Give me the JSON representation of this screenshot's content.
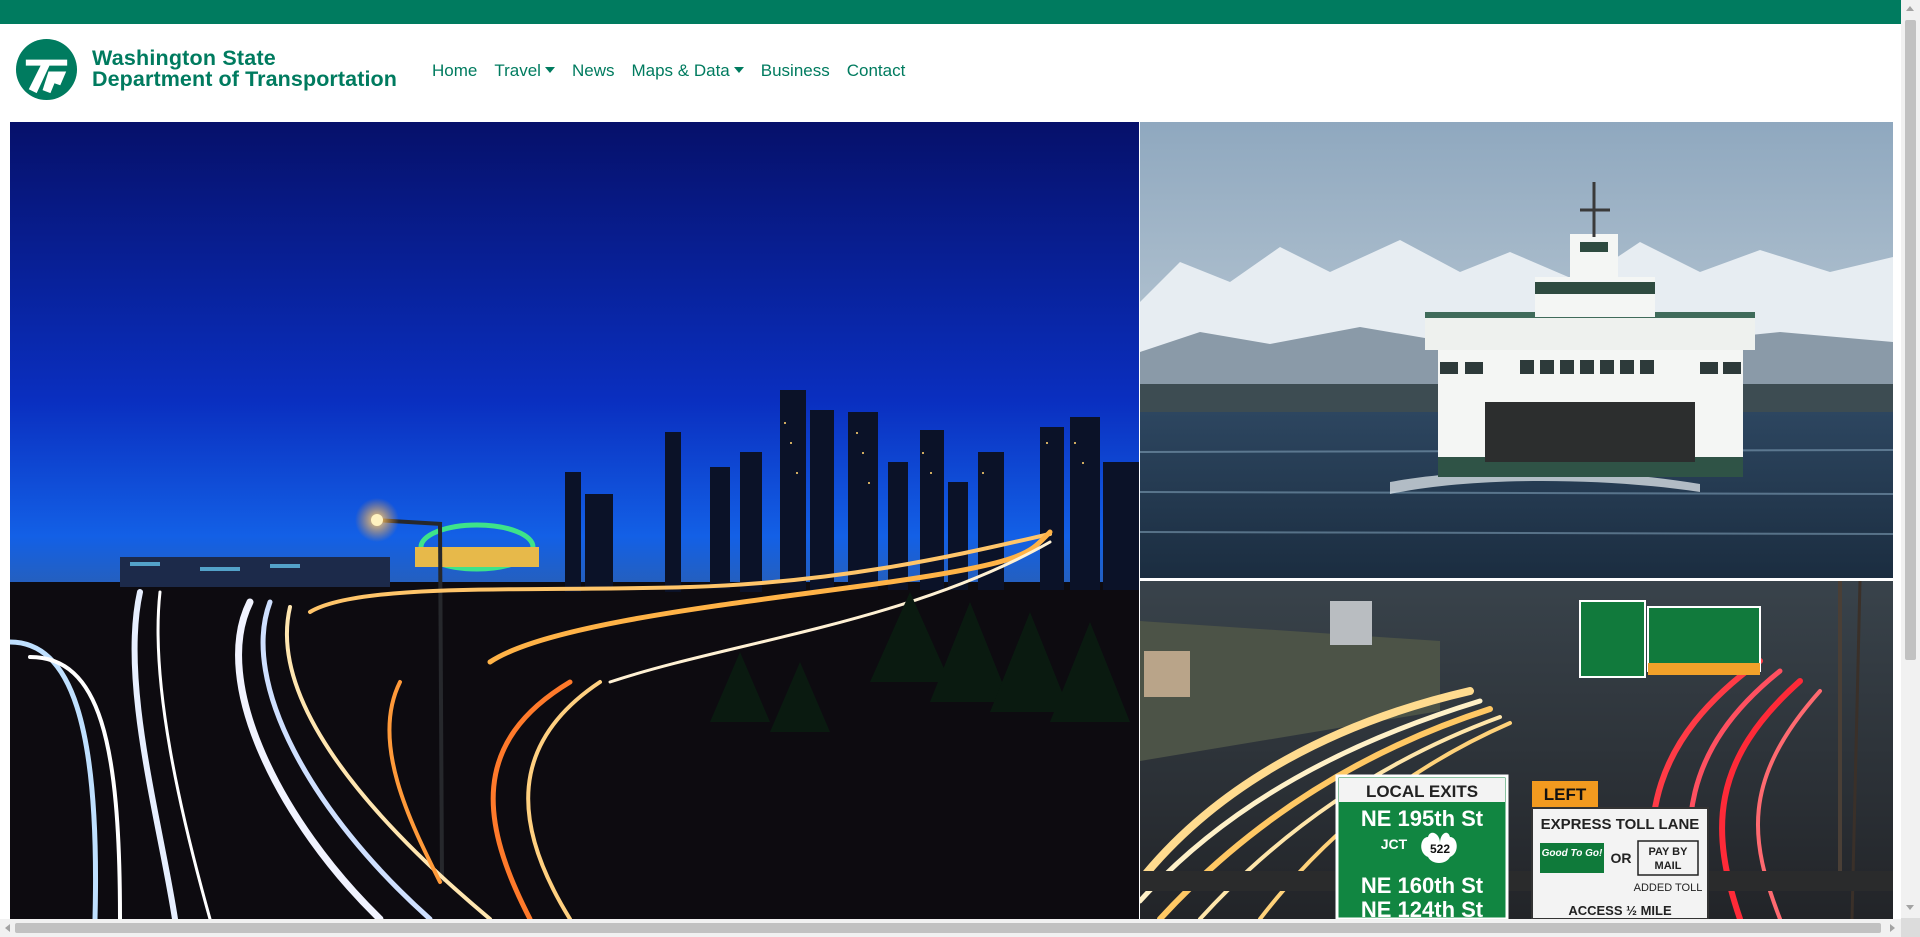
{
  "brand": {
    "name_line1": "Washington State",
    "name_line2": "Department of Transportation",
    "color": "#007b5f"
  },
  "nav": {
    "items": [
      {
        "label": "Home",
        "has_dropdown": false
      },
      {
        "label": "Travel",
        "has_dropdown": true
      },
      {
        "label": "News",
        "has_dropdown": false
      },
      {
        "label": "Maps & Data",
        "has_dropdown": true
      },
      {
        "label": "Business",
        "has_dropdown": false
      },
      {
        "label": "Contact",
        "has_dropdown": false
      }
    ]
  },
  "hero": {
    "traffic_signs": {
      "local_exits_header": "LOCAL EXITS",
      "exit_1": "NE 195th St",
      "junction": "JCT",
      "route": "522",
      "exit_2": "NE 160th St",
      "exit_3": "NE 124th St",
      "left_label": "LEFT",
      "express_lane": "EXPRESS TOLL LANE",
      "good_to_go": "Good To Go!",
      "or": "OR",
      "pay_by": "PAY BY",
      "mail": "MAIL",
      "added_toll": "ADDED TOLL",
      "access": "ACCESS ½ MILE"
    }
  },
  "colors": {
    "accent": "#007b5f",
    "page_bg": "#ffffff",
    "sign_green": "#0f7a3a",
    "sign_orange": "#f29a1f"
  }
}
